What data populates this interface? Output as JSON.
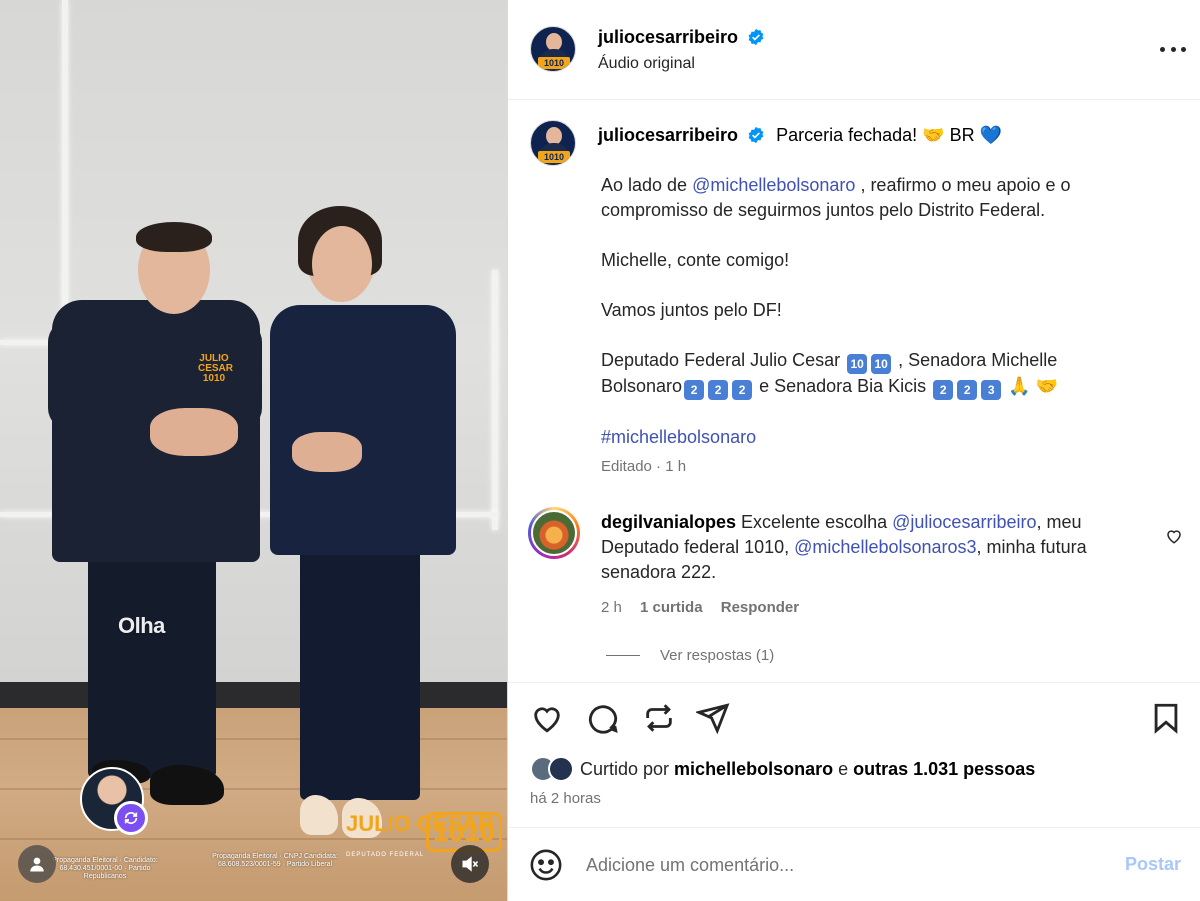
{
  "header": {
    "username": "juliocesarribeiro",
    "subtitle": "Áudio original",
    "verified": true
  },
  "caption": {
    "username": "juliocesarribeiro",
    "title": "Parceria fechada! 🤝 BR 💙",
    "line1_prefix": "Ao lado de ",
    "line1_mention": "@michellebolsonaro",
    "line1_suffix": " , reafirmo o meu apoio e o compromisso de seguirmos juntos pelo Distrito Federal.",
    "para2": "Michelle, conte comigo!",
    "para3": "Vamos juntos pelo DF!",
    "para4_a": "Deputado Federal Julio Cesar ",
    "para4_b": " , Senadora Michelle Bolsonaro",
    "para4_c": " e Senadora Bia Kicis ",
    "para4_end": " 🙏 🤝",
    "digit_keys": {
      "ten1": "10",
      "ten2": "10",
      "two1": "2",
      "two2": "2",
      "two3": "2",
      "two4": "2",
      "two5": "2",
      "three": "3"
    },
    "hashtag": "#michellebolsonaro",
    "meta": "Editado · 1 h"
  },
  "comment": {
    "username": "degilvanialopes",
    "text_a": " Excelente escolha ",
    "mention1": "@juliocesarribeiro",
    "text_b": ", meu Deputado federal 1010, ",
    "mention2": "@michellebolsonaros3",
    "text_c": ", minha futura senadora 222.",
    "time": "2 h",
    "likes": "1 curtida",
    "reply": "Responder",
    "view_replies": "Ver respostas (1)"
  },
  "engagement": {
    "liked_prefix": "Curtido por ",
    "liked_user": "michellebolsonaro",
    "liked_mid": " e ",
    "liked_others": "outras 1.031 pessoas",
    "posted_ago": "há 2 horas"
  },
  "add_comment": {
    "placeholder": "Adicione um comentário...",
    "post_label": "Postar"
  },
  "media": {
    "overlay_word": "Olha",
    "shirt_logo": "JULIO CESAR 1010",
    "brand_name": "JULIO CESAR",
    "brand_number": "1010",
    "brand_sub": "DEPUTADO FEDERAL",
    "legal_left": "Propaganda Eleitoral · Candidato: 68.430.451/0001-00 · Partido Republicanos",
    "legal_right": "Propaganda Eleitoral · CNPJ Candidata: 68.608.523/0001-59 · Partido Liberal"
  },
  "colors": {
    "link": "#3f51b5",
    "muted": "#737373",
    "post_button": "#a8c7fa",
    "brand_orange": "#f3a51a",
    "verified_blue": "#0095f6"
  }
}
